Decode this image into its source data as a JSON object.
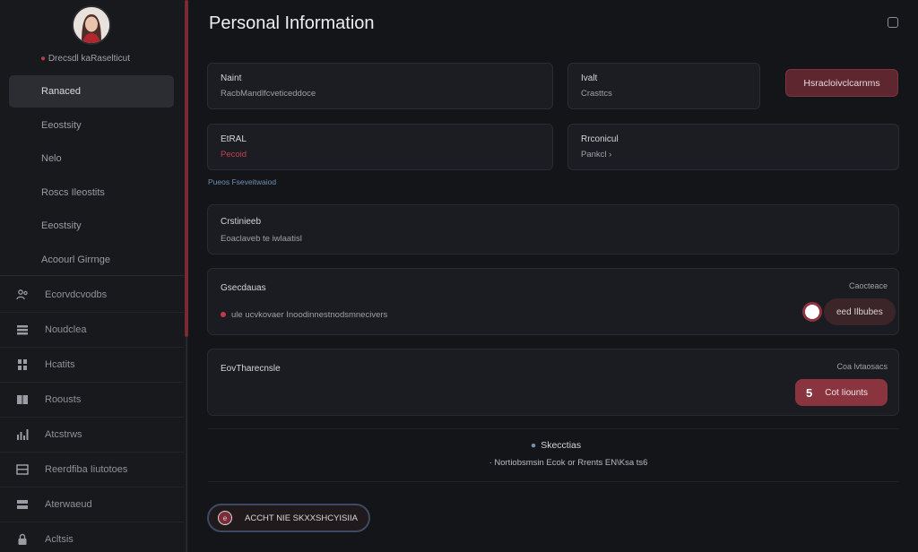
{
  "sidebar": {
    "user_name": "Drecsdl kaRaselticut",
    "nav_top": [
      {
        "label": "Ranaced",
        "active": true
      },
      {
        "label": "Eeostsity",
        "active": false
      },
      {
        "label": "Nelo",
        "active": false
      },
      {
        "label": "Roscs Ileostits",
        "active": false
      },
      {
        "label": "Eeostsity",
        "active": false
      },
      {
        "label": "Acoourl Girrnge",
        "active": false
      }
    ],
    "nav_bottom": [
      {
        "label": "Ecorvdcvodbs",
        "icon": "user-group-icon"
      },
      {
        "label": "Noudclea",
        "icon": "list-icon"
      },
      {
        "label": "Hcatits",
        "icon": "grid-icon"
      },
      {
        "label": "Roousts",
        "icon": "book-icon"
      },
      {
        "label": "Atcstrws",
        "icon": "bar-chart-icon"
      },
      {
        "label": "Reerdfiba Iiutotoes",
        "icon": "table-icon"
      },
      {
        "label": "Aterwaeud",
        "icon": "layers-icon"
      },
      {
        "label": "Acltsis",
        "icon": "lock-icon"
      }
    ]
  },
  "main": {
    "title": "Personal Information",
    "fields": {
      "name": {
        "label": "Naint",
        "value": "RacbMandlfcveticeddoce"
      },
      "last": {
        "label": "Ivalt",
        "value": "Crasttcs"
      },
      "email": {
        "label": "EtRAL",
        "value": "Pecoid"
      },
      "password": {
        "label": "Rrconicul",
        "value": "Pankcl ›"
      }
    },
    "primary_button": "Hsracloivclcarnms",
    "hint_link": "Pueos   Fseveitwaiod",
    "card_one": {
      "title": "Crstinieeb",
      "subtitle": "Eoaclaveb te iwlaatisl"
    },
    "card_two": {
      "title": "Gsecdauas",
      "right_label": "Caocteace",
      "subtitle": "ule ucvkovaer Inoodinnestnodsmnecivers",
      "button": "eed Ilbubes"
    },
    "card_three": {
      "title": "EovTharecnsle",
      "right_label": "Coa lvtaosacs",
      "button_number": "5",
      "button": "Cot Iiounts"
    },
    "footer": {
      "title": "Skecctias",
      "text": "· Nortiobsmsin Ecok  or  Rrents EN\\Ksa ts6"
    },
    "bottom_action": "ACCHT NIE SKXXSHCYISIIA"
  },
  "colors": {
    "accent": "#8a3440",
    "background": "#141519",
    "panel": "#1c1d22",
    "link": "#6f8fb6"
  }
}
